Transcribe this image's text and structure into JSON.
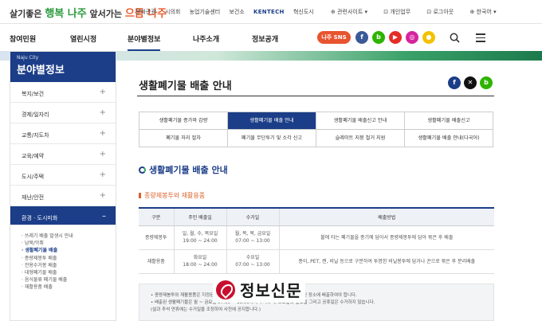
{
  "topbar": {
    "slogan": {
      "part1": "살기좋은",
      "brand1": "행복 나주",
      "part2": "앞서가는",
      "brand2": "으뜸 나주"
    },
    "links": [
      "문화관광",
      "시의회",
      "농업기술센터",
      "보건소",
      "KENTECH",
      "혁신도시"
    ],
    "right": [
      "관련사이트 ▾",
      "개인업무",
      "로그아웃",
      "한국어 ▾"
    ]
  },
  "gnb": {
    "menus": [
      "참여민원",
      "열린시정",
      "분야별정보",
      "나주소개",
      "정보공개"
    ],
    "sns_label": "나주 SNS",
    "sns_icons": [
      {
        "name": "facebook-icon",
        "glyph": "f",
        "color": "#3b5998"
      },
      {
        "name": "blog-icon",
        "glyph": "b",
        "color": "#2db400"
      },
      {
        "name": "youtube-icon",
        "glyph": "▶",
        "color": "#e52d27"
      },
      {
        "name": "instagram-icon",
        "glyph": "◎",
        "color": "#d6249f"
      },
      {
        "name": "kakao-icon",
        "glyph": "●",
        "color": "#f2c200"
      }
    ]
  },
  "sidebar": {
    "small": "Naju City",
    "title": "분야별정보",
    "items": [
      "복지/보건",
      "경제/일자리",
      "교통/지도차",
      "교육/예약",
      "도시/주택",
      "재난/안전"
    ],
    "active": "환경 · 도시미화",
    "sub": [
      "· 쓰레기 배출 발생시 안내",
      "· 남북/악취",
      "· 생활폐기물 배출",
      "· 종량제봉투 배출",
      "· 전용수거봉 배출",
      "· 대형폐기물 배출",
      "· 음식물류 폐기물 배출",
      "· 재활용품 배출"
    ],
    "sub_current": 2,
    "plus": "+",
    "minus": "–"
  },
  "page": {
    "title": "생활폐기물 배출 안내",
    "share_icons": [
      {
        "name": "facebook-share-icon",
        "glyph": "f",
        "color": "#1c3e88"
      },
      {
        "name": "x-share-icon",
        "glyph": "✕",
        "color": "#111111"
      },
      {
        "name": "blog-share-icon",
        "glyph": "b",
        "color": "#2db400"
      }
    ]
  },
  "tabs": {
    "row1": [
      "생활폐기물 증가와 감량",
      "생활폐기물 배출 안내",
      "생활폐기물 배출신고 안내",
      "생활폐기물 배출신고"
    ],
    "row2": [
      "폐기물 처리 절차",
      "폐기물 무단투기 및 소각 신고",
      "슬레이트 지붕 철거 지원",
      "생활폐기물 배출 안내(다국어)"
    ],
    "active_index": 1
  },
  "section": {
    "title": "생활폐기물 배출 안내",
    "subtitle": "종량제봉투와 재활용품"
  },
  "table": {
    "headers": [
      "구분",
      "주민 배출일",
      "수거일",
      "배출방법"
    ],
    "rows": [
      [
        "종량제봉투",
        "일, 월, 수, 목요일\n19:00 ~ 24:00",
        "월, 목, 목, 금요일\n07:00 ~ 13:00",
        "불에 타는 폐기물을 종기에 담아서 종량제봉투에 담아 묶은 후 배출"
      ],
      [
        "재활용품",
        "화요일\n18:00 ~ 24:00",
        "수요일\n07:00 ~ 13:00",
        "종이, PET, 캔, 비닐 등으로 구분하여 투명한 비닐봉투에 담거나 끈으로 묶은 후 분리배출"
      ]
    ]
  },
  "notes": [
    "• 종량제봉투와 재활용품은 지정된 시간에 배출하고, 가정에서는 건물주변이나 지정된 장소에 배출하여야 합니다.",
    "• 배출된 생활폐기물은 월 ~ 금요일 07:00 ~ 13:00까지 수거하며, 토요일과 일요일 그리고 공휴일은 수거하지 않습니다.",
    "  (설과 추석 연휴에는 수거일을 조정하여 사전에 공지합니다.)"
  ],
  "watermark": "정보신문"
}
